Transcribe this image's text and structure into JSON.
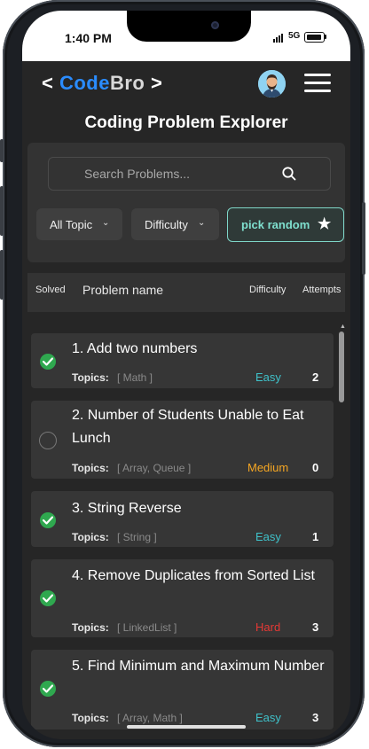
{
  "status": {
    "time": "1:40 PM",
    "network": "5G"
  },
  "header": {
    "logo_open": "<",
    "logo_code": "Code",
    "logo_bro": "Bro",
    "logo_close": ">",
    "page_title": "Coding Problem Explorer"
  },
  "filters": {
    "search_placeholder": "Search Problems...",
    "topic_dropdown": "All Topic",
    "difficulty_dropdown": "Difficulty",
    "pick_random": "pick random"
  },
  "table": {
    "headers": {
      "solved": "Solved",
      "name": "Problem name",
      "difficulty": "Difficulty",
      "attempts": "Attempts"
    },
    "topics_label": "Topics:",
    "problems": [
      {
        "title": "1. Add two numbers",
        "topics": "[ Math ]",
        "difficulty": "Easy",
        "attempts": "2",
        "solved": true
      },
      {
        "title": "2. Number of Students Unable to Eat Lunch",
        "topics": "[ Array, Queue ]",
        "difficulty": "Medium",
        "attempts": "0",
        "solved": false
      },
      {
        "title": "3. String Reverse",
        "topics": "[ String ]",
        "difficulty": "Easy",
        "attempts": "1",
        "solved": true
      },
      {
        "title": "4. Remove Duplicates from Sorted List",
        "topics": "[ LinkedList ]",
        "difficulty": "Hard",
        "attempts": "3",
        "solved": true
      },
      {
        "title": "5. Find Minimum and Maximum Number",
        "topics": "[ Array, Math ]",
        "difficulty": "Easy",
        "attempts": "3",
        "solved": true
      }
    ]
  },
  "colors": {
    "easy": "#3fc1c9",
    "medium": "#f5a623",
    "hard": "#e53935",
    "accent": "#2a8cff",
    "solved_check": "#2fa84f"
  },
  "icons": {
    "search": "search-icon",
    "chevron": "chevron-down-icon",
    "star": "star-icon",
    "menu": "hamburger-menu-icon",
    "avatar": "user-avatar",
    "solved": "check-circle-icon",
    "unsolved": "empty-circle-icon"
  }
}
